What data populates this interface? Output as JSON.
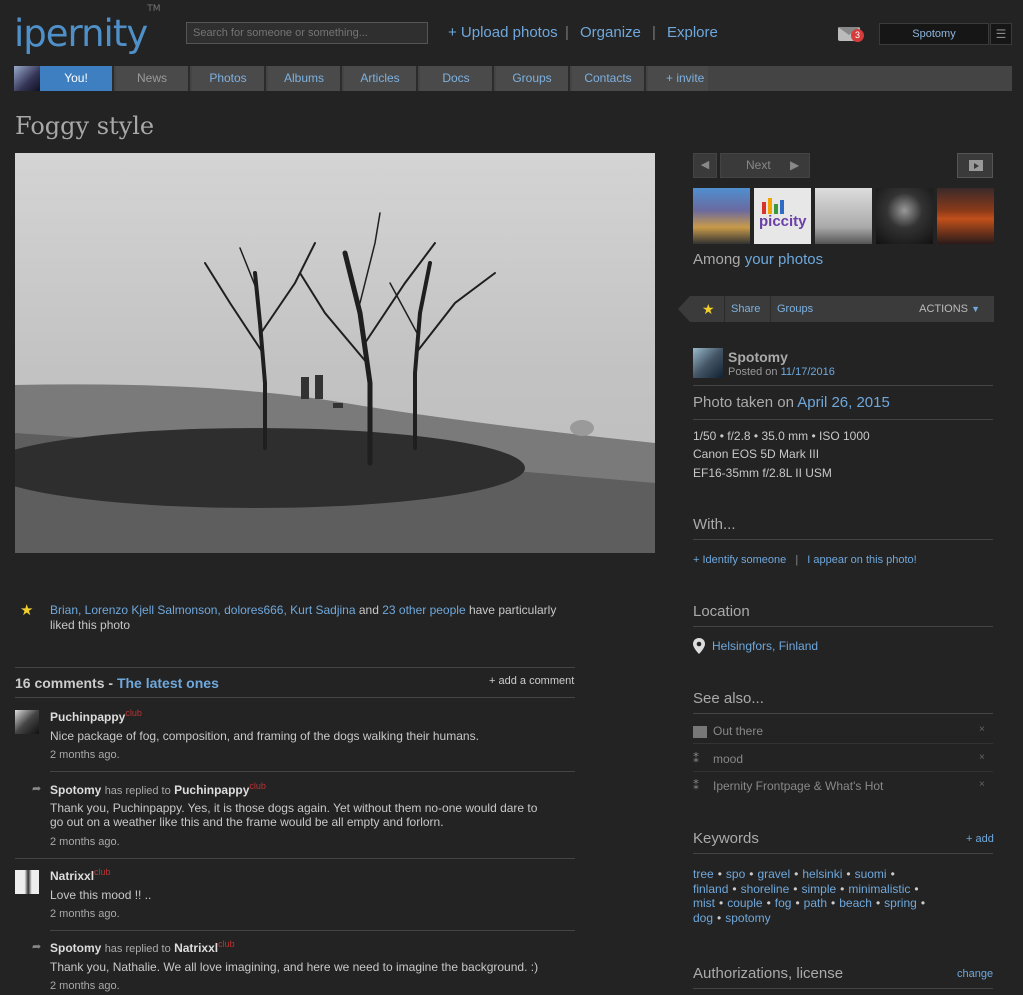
{
  "header": {
    "logo": "ipernity",
    "logo_tm": "TM",
    "search_placeholder": "Search for someone or something...",
    "nav": [
      "+ Upload photos",
      "Organize",
      "Explore"
    ],
    "mail_count": "3",
    "user": "Spotomy"
  },
  "tabs": [
    "You!",
    "News",
    "Photos",
    "Albums",
    "Articles",
    "Docs",
    "Groups",
    "Contacts",
    "+ invite"
  ],
  "photo": {
    "title": "Foggy style"
  },
  "sidebar": {
    "next_label": "Next",
    "among_prefix": "Among",
    "among_link": "your photos",
    "actions": {
      "share": "Share",
      "groups": "Groups",
      "actions": "ACTIONS"
    },
    "owner": {
      "name": "Spotomy",
      "posted_prefix": "Posted on",
      "posted_date": "11/17/2016"
    },
    "taken_prefix": "Photo taken on",
    "taken_date": "April 26, 2015",
    "exif": [
      "1/50  •  f/2.8  •  35.0 mm  •  ISO 1000",
      "Canon EOS 5D Mark III",
      "EF16-35mm f/2.8L II USM"
    ],
    "with_head": "With...",
    "identify": "+ Identify someone",
    "appear": "I appear on this photo!",
    "location_head": "Location",
    "location": "Helsingfors, Finland",
    "seealso_head": "See also...",
    "seealso": [
      "Out there",
      "mood",
      "Ipernity Frontpage & What's Hot"
    ],
    "keywords_head": "Keywords",
    "keywords_add": "+ add",
    "keywords": [
      [
        "tree",
        "spo",
        "gravel",
        "helsinki",
        "suomi"
      ],
      [
        "finland",
        "shoreline",
        "simple",
        "minimalistic"
      ],
      [
        "mist",
        "couple",
        "fog",
        "path",
        "beach",
        "spring"
      ],
      [
        "dog",
        "spotomy"
      ]
    ],
    "auth_head": "Authorizations, license",
    "auth_change": "change"
  },
  "likes": {
    "people": "Brian, Lorenzo Kjell Salmonson, dolores666, Kurt Sadjina",
    "and": " and ",
    "others": "23 other people",
    "suffix": " have particularly liked this photo"
  },
  "comments": {
    "count_label": "16 comments - ",
    "latest": "The latest ones",
    "add": "+ add a comment",
    "items": [
      {
        "user": "Puchinpappy",
        "club": "club",
        "text": "Nice package of fog, composition, and framing of the dogs walking their humans.",
        "date": "2 months ago."
      },
      {
        "user": "Spotomy",
        "replied": "has replied to",
        "to": "Puchinpappy",
        "club": "club",
        "text": "Thank you, Puchinpappy. Yes, it is those dogs again. Yet without them no-one would dare to go out on a weather like this and the frame would be all empty and forlorn.",
        "date": "2 months ago."
      },
      {
        "user": "Natrixxl",
        "club": "club",
        "text": "Love this mood !! ..",
        "date": "2 months ago."
      },
      {
        "user": "Spotomy",
        "replied": "has replied to",
        "to": "Natrixxl",
        "club": "club",
        "text": "Thank you, Nathalie. We all love imagining, and here we need to imagine the background. :)",
        "date": "2 months ago."
      }
    ]
  }
}
